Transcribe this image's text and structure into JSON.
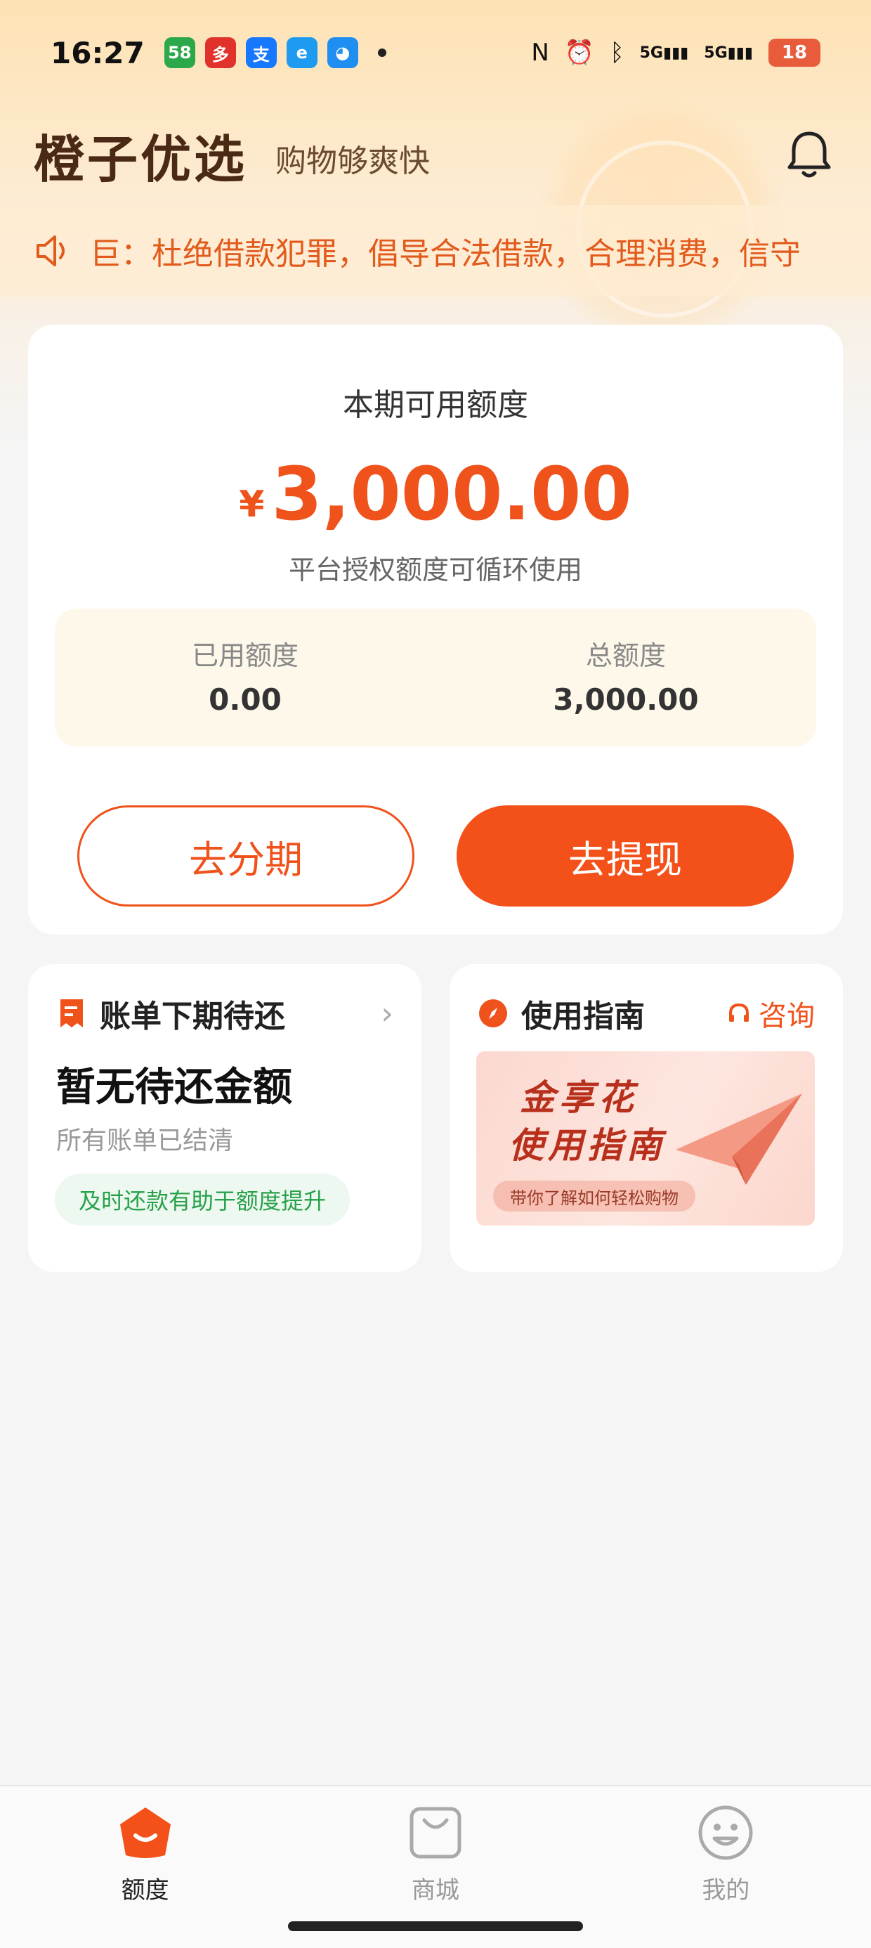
{
  "status_bar": {
    "time": "16:27",
    "apps": [
      {
        "name": "58-app-icon",
        "label": "58",
        "color": "#2aa84a"
      },
      {
        "name": "pinduoduo-app-icon",
        "label": "多",
        "color": "#e0312a"
      },
      {
        "name": "alipay-app-icon",
        "label": "支",
        "color": "#1677ff"
      },
      {
        "name": "eleme-app-icon",
        "label": "e",
        "color": "#1e9bf0"
      },
      {
        "name": "bird-app-icon",
        "label": "◕",
        "color": "#1e8ef0"
      }
    ],
    "signal_1": "5G",
    "signal_2": "5G",
    "battery": "18"
  },
  "header": {
    "title": "橙子优选",
    "subtitle": "购物够爽快"
  },
  "notice": {
    "text": "巨：杜绝借款犯罪，倡导合法借款，合理消费，信守"
  },
  "credit": {
    "label": "本期可用额度",
    "currency": "¥",
    "amount": "3,000.00",
    "note": "平台授权额度可循环使用",
    "used_label": "已用额度",
    "used_value": "0.00",
    "total_label": "总额度",
    "total_value": "3,000.00",
    "installment_button": "去分期",
    "withdraw_button": "去提现"
  },
  "bill": {
    "title": "账单下期待还",
    "main": "暂无待还金额",
    "sub": "所有账单已结清",
    "tip": "及时还款有助于额度提升"
  },
  "guide": {
    "title": "使用指南",
    "consult": "咨询",
    "banner_title_1": "金享花",
    "banner_title_2": "使用指南",
    "banner_sub": "带你了解如何轻松购物"
  },
  "tabs": [
    {
      "label": "额度",
      "active": true
    },
    {
      "label": "商城",
      "active": false
    },
    {
      "label": "我的",
      "active": false
    }
  ],
  "colors": {
    "accent": "#f4511a",
    "brand_title": "#4a2a14",
    "success": "#27a14a"
  }
}
